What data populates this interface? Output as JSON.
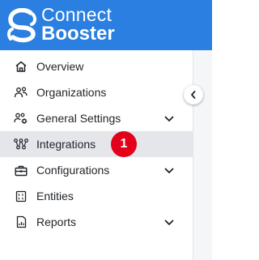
{
  "brand": {
    "line1": "Connect",
    "line2": "Booster",
    "color": "#2a7fe0"
  },
  "sidebar": {
    "items": [
      {
        "label": "Overview",
        "icon": "home-icon",
        "has_chevron": false,
        "active": false
      },
      {
        "label": "Organizations",
        "icon": "people-icon",
        "has_chevron": false,
        "active": false
      },
      {
        "label": "General Settings",
        "icon": "people-gear-icon",
        "has_chevron": true,
        "active": false
      },
      {
        "label": "Integrations",
        "icon": "integrations-icon",
        "has_chevron": false,
        "active": true
      },
      {
        "label": "Configurations",
        "icon": "toolbox-icon",
        "has_chevron": true,
        "active": false
      },
      {
        "label": "Entities",
        "icon": "entities-icon",
        "has_chevron": false,
        "active": false
      },
      {
        "label": "Reports",
        "icon": "report-icon",
        "has_chevron": true,
        "active": false
      }
    ]
  },
  "badge": {
    "text": "1",
    "color": "#e3001b"
  },
  "collapse_button": {
    "icon": "chevron-left-icon"
  }
}
